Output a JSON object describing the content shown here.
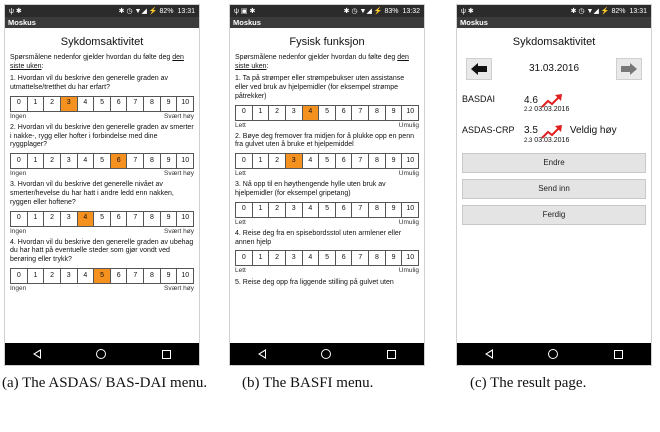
{
  "phone1": {
    "status": {
      "left_icons": "ψ ✱",
      "right_icons": "✱ ◷ ▼◢ ⚡ 82%",
      "battery": "82%",
      "time": "13:31"
    },
    "app_title": "Moskus",
    "title": "Sykdomsaktivitet",
    "intro_a": "Spørsmålene nedenfor gjelder hvordan du følte deg ",
    "intro_b": "den siste uken",
    "intro_c": ":",
    "questions": [
      {
        "text": "1. Hvordan vil du beskrive den generelle graden av utmattelse/tretthet du har erfart?",
        "selected": 3,
        "left": "Ingen",
        "right": "Svært høy"
      },
      {
        "text": "2. Hvordan vil du beskrive den generelle graden av smerter i nakke-, rygg eller hofter i forbindelse med dine ryggplager?",
        "selected": 6,
        "left": "Ingen",
        "right": "Svært høy"
      },
      {
        "text": "3. Hvordan vil du beskrive det generelle nivået av smerter/hevelse du har hatt i andre ledd enn nakken, ryggen eller hoftene?",
        "selected": 4,
        "left": "Ingen",
        "right": "Svært høy"
      },
      {
        "text": "4. Hvordan vil du beskrive den generelle graden av ubehag du har hatt på eventuelle steder som gjør vondt ved berøring eller trykk?",
        "selected": 5,
        "left": "Ingen",
        "right": "Svært høy"
      }
    ]
  },
  "phone2": {
    "status": {
      "left_icons": "ψ ▣ ✱",
      "right_icons": "✱ ◷ ▼◢ ⚡ 83%",
      "time": "13:32"
    },
    "app_title": "Moskus",
    "title": "Fysisk funksjon",
    "intro_a": "Spørsmålene nedenfor gjelder hvordan du følte deg ",
    "intro_b": "den siste uken",
    "intro_c": ":",
    "questions": [
      {
        "text": "1. Ta på strømper eller strømpebukser uten assistanse eller ved bruk av hjelpemidler (for eksempel strømpe påtrekker)",
        "selected": 4,
        "left": "Lett",
        "right": "Umulig"
      },
      {
        "text": "2. Bøye deg fremover fra midjen for å plukke opp en penn fra gulvet uten å bruke et hjelpemiddel",
        "selected": 3,
        "left": "Lett",
        "right": "Umulig"
      },
      {
        "text": "3. Nå opp til en høythengende hylle uten bruk av hjelpemidler (for eksempel gripetang)",
        "selected": -1,
        "left": "Lett",
        "right": "Umulig"
      },
      {
        "text": "4. Reise deg fra en spisebordsstol uten armlener eller annen hjelp",
        "selected": -1,
        "left": "Lett",
        "right": "Umulig"
      }
    ],
    "partial_question": "5. Reise deg opp fra liggende stilling på gulvet uten"
  },
  "phone3": {
    "status": {
      "left_icons": "ψ ✱",
      "right_icons": "✱ ◷ ▼◢ ⚡ 82%",
      "time": "13:31"
    },
    "app_title": "Moskus",
    "title": "Sykdomsaktivitet",
    "date": "31.03.2016",
    "results": [
      {
        "label": "BASDAI",
        "value": "4.6",
        "extra": "",
        "prev_value": "2.2",
        "prev_date": "03.03.2016"
      },
      {
        "label": "ASDAS-CRP",
        "value": "3.5",
        "extra": "Veldig høy",
        "prev_value": "2.3",
        "prev_date": "03.03.2016"
      }
    ],
    "buttons": {
      "edit": "Endre",
      "submit": "Send inn",
      "done": "Ferdig"
    }
  },
  "scale_numbers": [
    "0",
    "1",
    "2",
    "3",
    "4",
    "5",
    "6",
    "7",
    "8",
    "9",
    "10"
  ],
  "captions": {
    "a": "(a) The ASDAS/ BAS-DAI menu.",
    "b": "(b) The BASFI menu.",
    "c": "(c) The result page."
  },
  "colors": {
    "selected": "#f4911f",
    "trend": "#e02020",
    "bar": "#2b2b2b"
  }
}
